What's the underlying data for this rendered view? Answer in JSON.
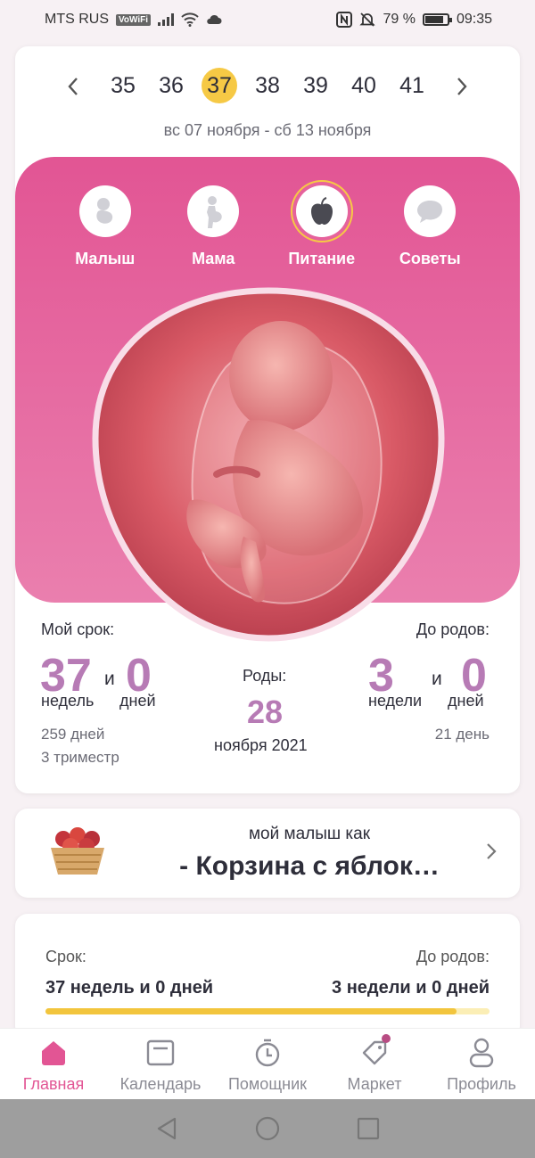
{
  "status_bar": {
    "carrier": "MTS RUS",
    "vowifi": "VoWiFi",
    "battery": "79 %",
    "time": "09:35"
  },
  "week_selector": {
    "weeks": [
      "35",
      "36",
      "37",
      "38",
      "39",
      "40",
      "41"
    ],
    "selected": "37",
    "date_range": "вс 07 ноября - сб 13 ноября"
  },
  "tabs": [
    {
      "label": "Малыш",
      "icon": "baby-icon"
    },
    {
      "label": "Мама",
      "icon": "pregnant-icon"
    },
    {
      "label": "Питание",
      "icon": "apple-icon",
      "active": true
    },
    {
      "label": "Советы",
      "icon": "chat-icon"
    }
  ],
  "term": {
    "label": "Мой срок:",
    "weeks": "37",
    "connector": "и",
    "days": "0",
    "weeks_unit": "недель",
    "days_unit": "дней",
    "total_days": "259 дней",
    "trimester": "3 триместр"
  },
  "due": {
    "label": "Роды:",
    "day": "28",
    "month_year": "ноября 2021"
  },
  "remaining": {
    "label": "До родов:",
    "weeks": "3",
    "connector": "и",
    "days": "0",
    "weeks_unit": "недели",
    "days_unit": "дней",
    "total_days": "21 день"
  },
  "baby_size": {
    "title": "мой малыш как",
    "fruit": "- Корзина с яблок…"
  },
  "progress": {
    "term_label": "Срок:",
    "term_value": "37 недель и 0 дней",
    "remaining_label": "До родов:",
    "remaining_value": "3 недели и 0 дней",
    "fraction": 0.925
  },
  "bottom_nav": [
    {
      "label": "Главная",
      "icon": "home-icon",
      "active": true
    },
    {
      "label": "Календарь",
      "icon": "calendar-icon"
    },
    {
      "label": "Помощник",
      "icon": "timer-icon"
    },
    {
      "label": "Маркет",
      "icon": "tag-icon",
      "badge": true
    },
    {
      "label": "Профиль",
      "icon": "profile-icon"
    }
  ],
  "colors": {
    "accent_pink": "#e25594",
    "accent_purple": "#b77bb5",
    "highlight_yellow": "#f6c945"
  }
}
